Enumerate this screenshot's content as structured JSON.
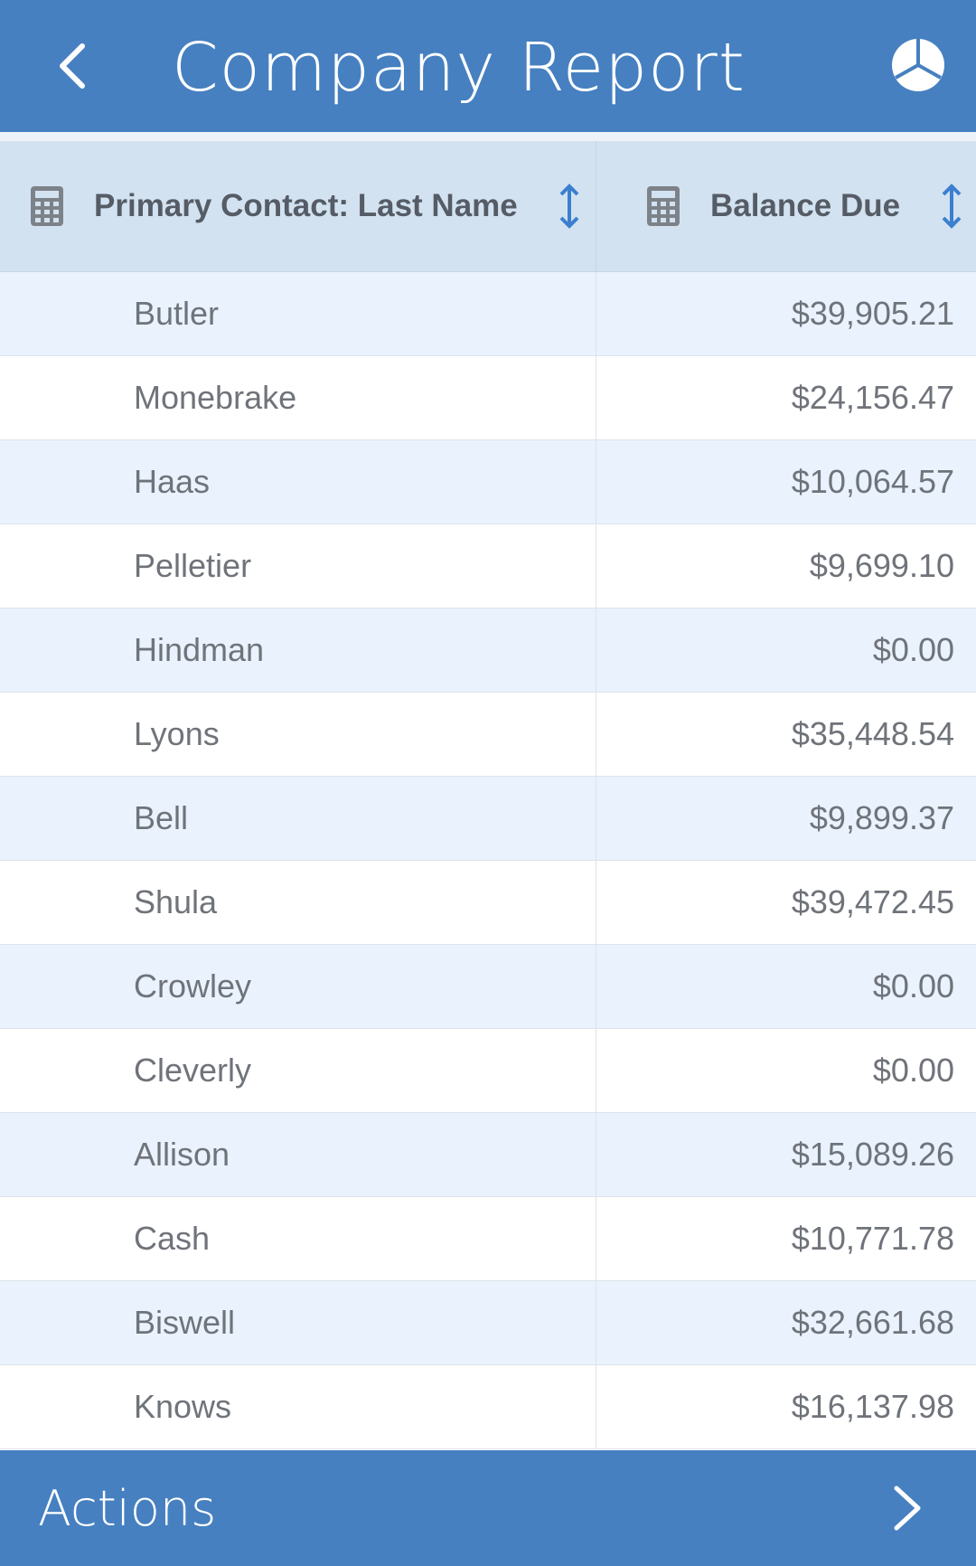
{
  "header": {
    "title": "Company Report",
    "back_icon": "chevron-left-icon",
    "action_icon": "pie-chart-icon"
  },
  "table": {
    "columns": [
      {
        "label": "Primary Contact: Last Name",
        "type_icon": "calculator-icon",
        "sort_icon": "sort-vertical-arrows-icon"
      },
      {
        "label": "Balance Due",
        "type_icon": "calculator-icon",
        "sort_icon": "sort-vertical-arrows-icon"
      }
    ],
    "rows": [
      {
        "last_name": "Butler",
        "balance": "$39,905.21"
      },
      {
        "last_name": "Monebrake",
        "balance": "$24,156.47"
      },
      {
        "last_name": "Haas",
        "balance": "$10,064.57"
      },
      {
        "last_name": "Pelletier",
        "balance": "$9,699.10"
      },
      {
        "last_name": "Hindman",
        "balance": "$0.00"
      },
      {
        "last_name": "Lyons",
        "balance": "$35,448.54"
      },
      {
        "last_name": "Bell",
        "balance": "$9,899.37"
      },
      {
        "last_name": "Shula",
        "balance": "$39,472.45"
      },
      {
        "last_name": "Crowley",
        "balance": "$0.00"
      },
      {
        "last_name": "Cleverly",
        "balance": "$0.00"
      },
      {
        "last_name": "Allison",
        "balance": "$15,089.26"
      },
      {
        "last_name": "Cash",
        "balance": "$10,771.78"
      },
      {
        "last_name": "Biswell",
        "balance": "$32,661.68"
      },
      {
        "last_name": "Knows",
        "balance": "$16,137.98"
      }
    ]
  },
  "footer": {
    "label": "Actions",
    "icon": "chevron-right-icon"
  },
  "colors": {
    "primary": "#4680c0",
    "header_row": "#d3e2f1",
    "alt_row": "#eaf2fd",
    "text": "#6f737a"
  }
}
